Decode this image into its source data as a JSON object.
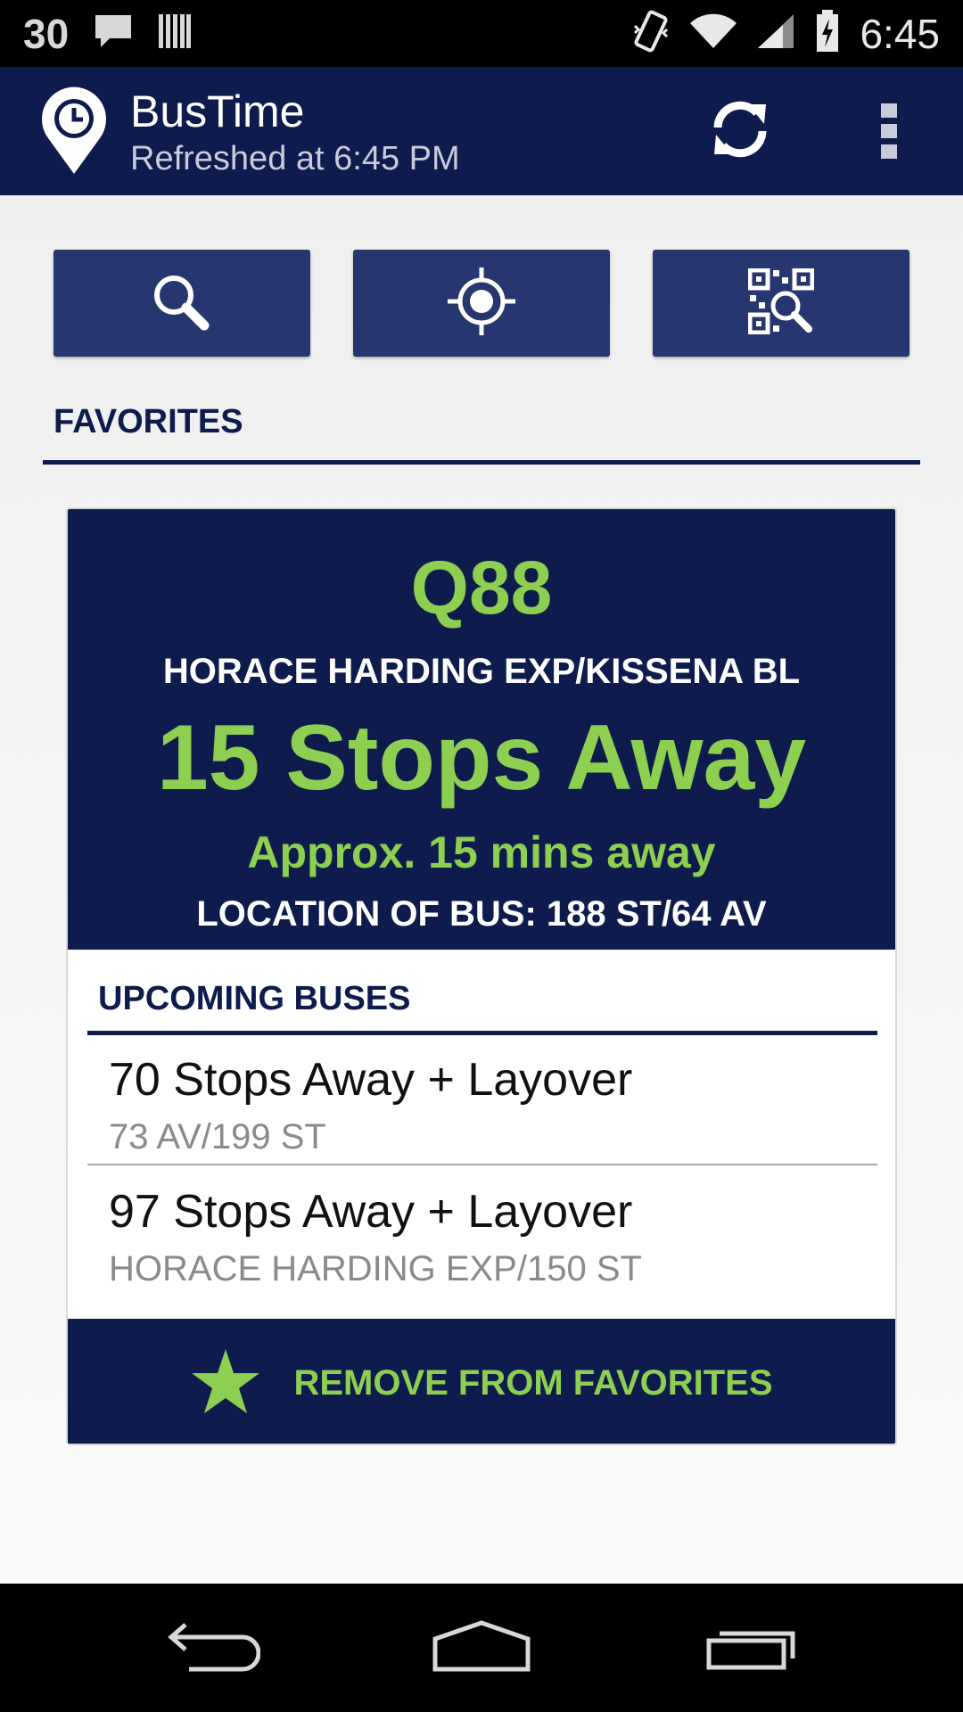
{
  "status_bar": {
    "notification_count": "30",
    "time": "6:45",
    "icons": [
      "chat-bubble-icon",
      "barcode-icon",
      "vibrate-icon",
      "wifi-icon",
      "cell-signal-icon",
      "battery-charging-icon"
    ]
  },
  "app_bar": {
    "title": "BusTime",
    "subtitle": "Refreshed at 6:45 PM",
    "icons": [
      "bustime-logo-icon",
      "refresh-icon",
      "overflow-menu-icon"
    ]
  },
  "actions": {
    "icons": [
      "search-icon",
      "locate-icon",
      "qr-scan-icon"
    ]
  },
  "favorites": {
    "header": "FAVORITES",
    "card": {
      "route": "Q88",
      "stop_name": "HORACE HARDING EXP/KISSENA BL",
      "distance": "15 Stops Away",
      "approx": "Approx. 15 mins away",
      "location": "LOCATION OF BUS: 188 ST/64 AV",
      "upcoming_header": "UPCOMING BUSES",
      "upcoming": [
        {
          "distance": "70 Stops Away + Layover",
          "location": "73 AV/199 ST"
        },
        {
          "distance": "97 Stops Away + Layover",
          "location": "HORACE HARDING EXP/150 ST"
        }
      ],
      "remove_label": "REMOVE FROM FAVORITES"
    }
  },
  "nav_bar": {
    "icons": [
      "back-icon",
      "home-icon",
      "recent-apps-icon"
    ]
  },
  "colors": {
    "primary_navy": "#0d1b4d",
    "button_navy": "#26366e",
    "accent_green": "#8dcf50"
  }
}
